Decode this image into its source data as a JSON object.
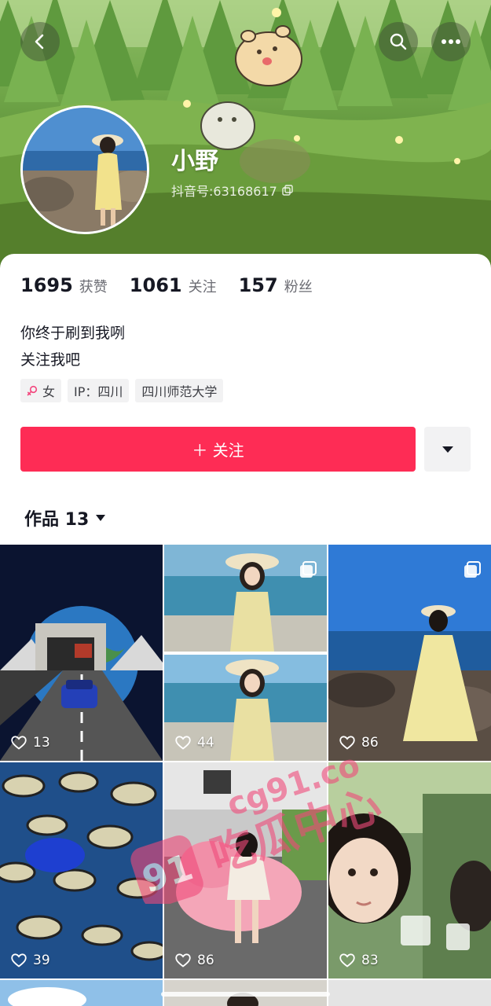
{
  "header": {
    "nickname": "小野",
    "douyin_id": "抖音号:63168617",
    "back_icon": "chevron-left-icon",
    "search_icon": "search-icon",
    "more_icon": "more-dots-icon"
  },
  "stats": [
    {
      "value": "1695",
      "label": "获赞"
    },
    {
      "value": "1061",
      "label": "关注"
    },
    {
      "value": "157",
      "label": "粉丝"
    }
  ],
  "bio": {
    "line1": "你终于刷到我咧",
    "line2": "关注我吧"
  },
  "tags": {
    "gender": "女",
    "ip": "IP：四川",
    "school": "四川师范大学"
  },
  "follow": {
    "label": "＋ 关注"
  },
  "works": {
    "label": "作品 13"
  },
  "grid": [
    {
      "likes": "13"
    },
    {
      "likes": "44"
    },
    {
      "likes": "86"
    },
    {
      "likes": "39"
    },
    {
      "likes": "86"
    },
    {
      "likes": "83"
    }
  ],
  "watermark": {
    "line1": "cg91.co",
    "line2": "吃瓜中心",
    "mark": "91"
  },
  "colors": {
    "accent": "#fe2c55",
    "text": "#161823",
    "muted": "#6b6c73",
    "tag_bg": "#f2f2f3"
  }
}
